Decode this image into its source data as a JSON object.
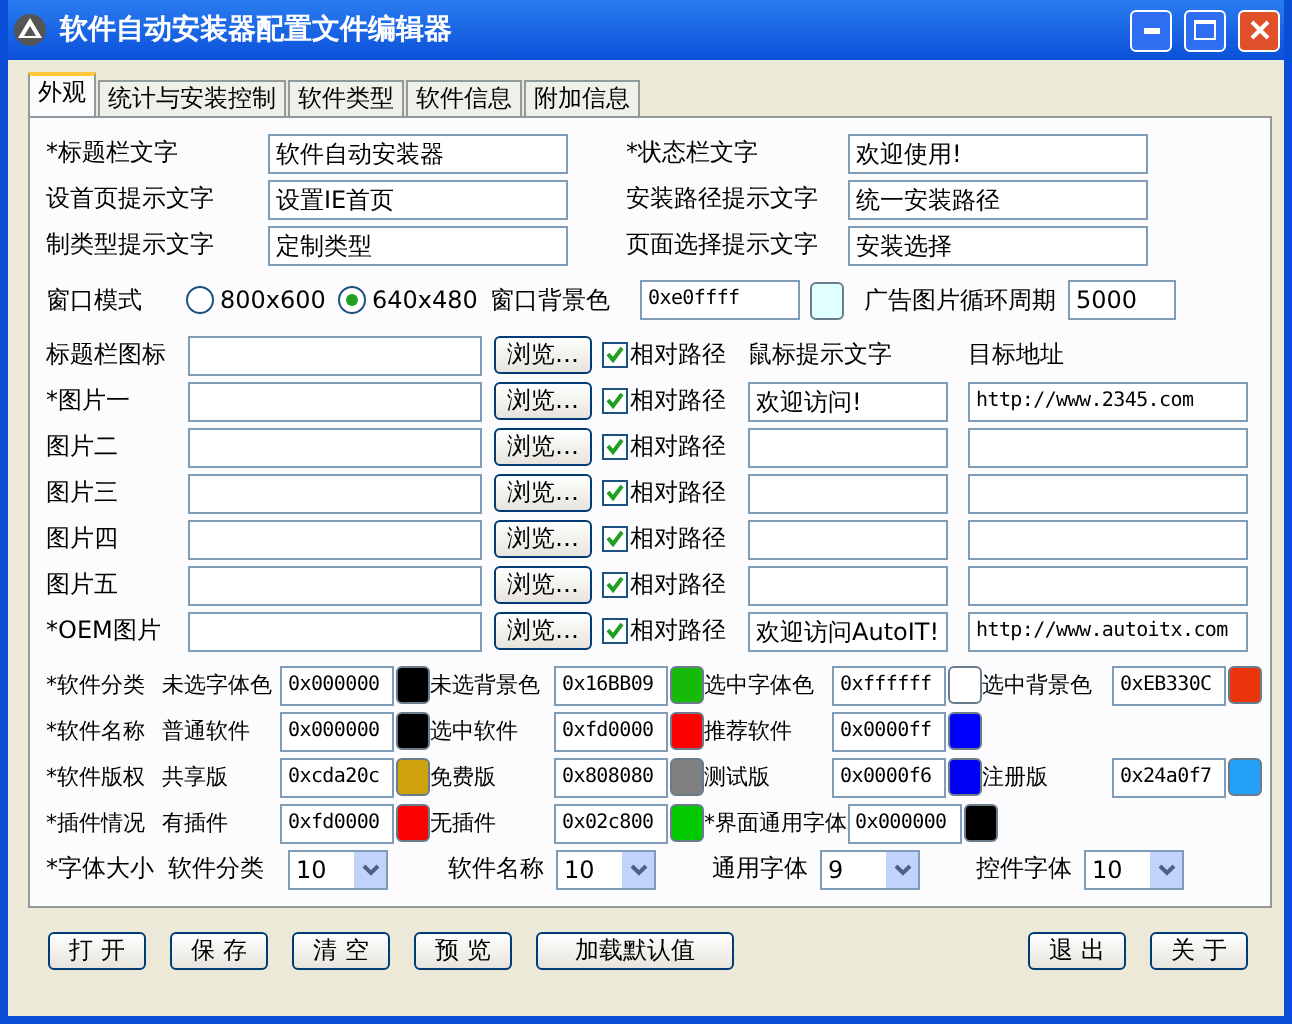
{
  "window": {
    "title": "软件自动安装器配置文件编辑器"
  },
  "tabs": [
    {
      "label": "外观",
      "selected": true
    },
    {
      "label": "统计与安装控制",
      "selected": false
    },
    {
      "label": "软件类型",
      "selected": false
    },
    {
      "label": "软件信息",
      "selected": false
    },
    {
      "label": "附加信息",
      "selected": false
    }
  ],
  "text_fields": [
    {
      "label": "*标题栏文字",
      "value": "软件自动安装器"
    },
    {
      "label": "*状态栏文字",
      "value": "欢迎使用!"
    },
    {
      "label": "设首页提示文字",
      "value": "设置IE首页"
    },
    {
      "label": "安装路径提示文字",
      "value": "统一安装路径"
    },
    {
      "label": "制类型提示文字",
      "value": "定制类型"
    },
    {
      "label": "页面选择提示文字",
      "value": "安装选择"
    }
  ],
  "window_mode": {
    "label": "窗口模式",
    "options": [
      {
        "label": "800x600",
        "selected": false
      },
      {
        "label": "640x480",
        "selected": true
      }
    ]
  },
  "background_color": {
    "label": "窗口背景色",
    "value": "0xe0ffff",
    "color": "#e0ffff"
  },
  "ad_cycle": {
    "label": "广告图片循环周期",
    "value": "5000"
  },
  "images": {
    "headers": [
      "鼠标提示文字",
      "目标地址"
    ],
    "rows": [
      {
        "label": "标题栏图标",
        "browse": "浏览…",
        "relative": {
          "label": "相对路径",
          "checked": true
        }
      },
      {
        "label": "*图片一",
        "browse": "浏览…",
        "relative": {
          "label": "相对路径",
          "checked": true
        },
        "tip": "欢迎访问!",
        "url": "http://www.2345.com"
      },
      {
        "label": "图片二",
        "browse": "浏览…",
        "relative": {
          "label": "相对路径",
          "checked": true
        }
      },
      {
        "label": "图片三",
        "browse": "浏览…",
        "relative": {
          "label": "相对路径",
          "checked": true
        }
      },
      {
        "label": "图片四",
        "browse": "浏览…",
        "relative": {
          "label": "相对路径",
          "checked": true
        }
      },
      {
        "label": "图片五",
        "browse": "浏览…",
        "relative": {
          "label": "相对路径",
          "checked": true
        }
      },
      {
        "label": "*OEM图片",
        "browse": "浏览…",
        "relative": {
          "label": "相对路径",
          "checked": true
        },
        "tip": "欢迎访问AutoIT!",
        "url": "http://www.autoitx.com"
      }
    ]
  },
  "colors": [
    {
      "label": "*软件分类",
      "items": [
        {
          "label": "未选字体色",
          "value": "0x000000",
          "color": "#000000"
        },
        {
          "label": "未选背景色",
          "value": "0x16BB09",
          "color": "#16bb09"
        },
        {
          "label": "选中字体色",
          "value": "0xffffff",
          "color": "#ffffff"
        },
        {
          "label": "选中背景色",
          "value": "0xEB330C",
          "color": "#eb330c"
        }
      ]
    },
    {
      "label": "*软件名称",
      "items": [
        {
          "label": "普通软件",
          "value": "0x000000",
          "color": "#000000"
        },
        {
          "label": "选中软件",
          "value": "0xfd0000",
          "color": "#fd0000"
        },
        {
          "label": "推荐软件",
          "value": "0x0000ff",
          "color": "#0000ff"
        }
      ]
    },
    {
      "label": "*软件版权",
      "items": [
        {
          "label": "共享版",
          "value": "0xcda20c",
          "color": "#cda20c"
        },
        {
          "label": "免费版",
          "value": "0x808080",
          "color": "#808080"
        },
        {
          "label": "测试版",
          "value": "0x0000f6",
          "color": "#0000f6"
        },
        {
          "label": "注册版",
          "value": "0x24a0f7",
          "color": "#24a0f7"
        }
      ]
    },
    {
      "label": "*插件情况",
      "items": [
        {
          "label": "有插件",
          "value": "0xfd0000",
          "color": "#fd0000"
        },
        {
          "label": "无插件",
          "value": "0x02c800",
          "color": "#02c800"
        },
        {
          "label": "*界面通用字体",
          "value": "0x000000",
          "color": "#000000"
        }
      ]
    }
  ],
  "font_sizes": {
    "label": "*字体大小",
    "items": [
      {
        "label": "软件分类",
        "value": "10"
      },
      {
        "label": "软件名称",
        "value": "10"
      },
      {
        "label": "通用字体",
        "value": "9"
      },
      {
        "label": "控件字体",
        "value": "10"
      }
    ]
  },
  "buttons": [
    {
      "label": "打 开"
    },
    {
      "label": "保 存"
    },
    {
      "label": "清 空"
    },
    {
      "label": "预 览"
    },
    {
      "label": "加载默认值"
    },
    {
      "label": "退 出"
    },
    {
      "label": "关 于"
    }
  ]
}
